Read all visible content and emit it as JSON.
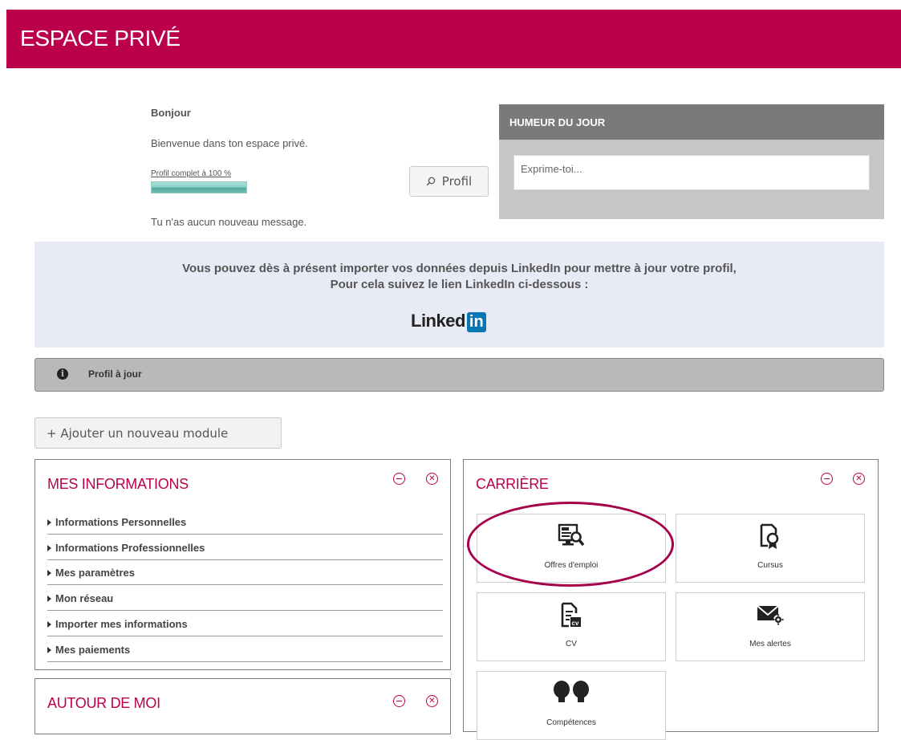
{
  "header": {
    "title": "ESPACE PRIVÉ"
  },
  "greeting": {
    "hello": "Bonjour",
    "welcome": "Bienvenue dans ton espace privé.",
    "profile_complete_label": "Profil complet à 100 %",
    "profile_complete_value": 100,
    "no_message": "Tu n'as aucun nouveau message."
  },
  "profile_button": {
    "label": "Profil",
    "icon": "search-icon"
  },
  "humeur": {
    "title": "HUMEUR DU JOUR",
    "placeholder": "Exprime-toi..."
  },
  "linkedin_banner": {
    "line1": "Vous pouvez dès à présent importer vos données depuis LinkedIn pour mettre à jour votre profil,",
    "line2": "Pour cela suivez le lien LinkedIn ci-dessous :",
    "logo_word": "Linked",
    "logo_box": "in",
    "brand_color": "#0a77b5"
  },
  "info_bar": {
    "text": "Profil à jour",
    "icon": "info-icon"
  },
  "add_module": {
    "label": "+ Ajouter un nouveau module"
  },
  "panels": {
    "mes_informations": {
      "title": "MES INFORMATIONS",
      "items": [
        "Informations Personnelles",
        "Informations Professionnelles",
        "Mes paramètres",
        "Mon réseau",
        "Importer mes informations",
        "Mes paiements"
      ]
    },
    "autour_de_moi": {
      "title": "AUTOUR DE MOI"
    },
    "carriere": {
      "title": "CARRIÈRE",
      "tiles": [
        {
          "label": "Offres d'emploi",
          "icon": "job-search-icon",
          "highlighted": true
        },
        {
          "label": "Cursus",
          "icon": "certificate-icon"
        },
        {
          "label": "CV",
          "icon": "cv-document-icon"
        },
        {
          "label": "Mes alertes",
          "icon": "mail-settings-icon"
        },
        {
          "label": "Compétences",
          "icon": "lightbulbs-icon"
        }
      ]
    }
  },
  "colors": {
    "brand": "#bb004c",
    "panel_gray": "#c6c6c6",
    "banner_bg": "#e8ebf5"
  }
}
